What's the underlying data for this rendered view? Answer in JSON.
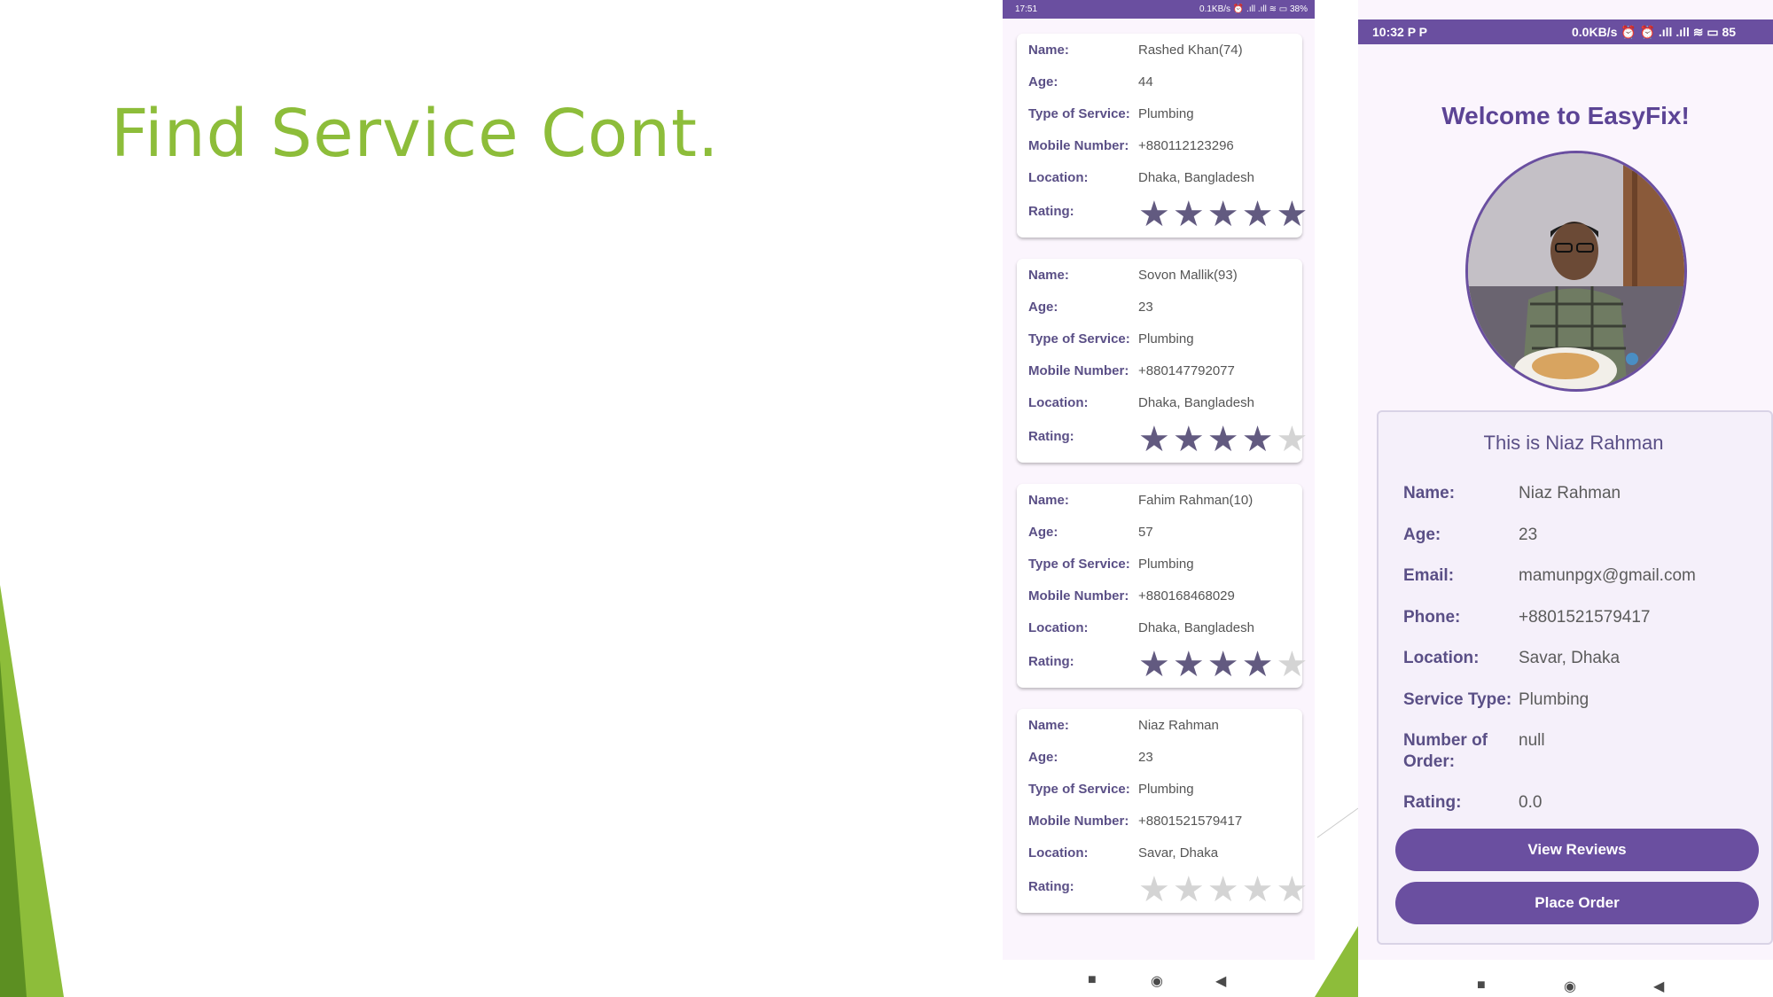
{
  "slide": {
    "title": "Find Service Cont."
  },
  "colors": {
    "accent_green": "#8dbd3a",
    "app_purple": "#6a4fa0",
    "label_purple": "#5a4f86"
  },
  "phone1": {
    "status": {
      "time": "17:51",
      "right": "0.1KB/s ⏰ .ıll .ıll ≋ ▭ 38%"
    },
    "field_labels": {
      "name": "Name:",
      "age": "Age:",
      "type": "Type of Service:",
      "mobile": "Mobile Number:",
      "location": "Location:",
      "rating": "Rating:"
    },
    "cards": [
      {
        "name": "Rashed Khan(74)",
        "age": "44",
        "type": "Plumbing",
        "mobile": "+880112123296",
        "location": "Dhaka, Bangladesh",
        "rating": 4.5
      },
      {
        "name": "Sovon Mallik(93)",
        "age": "23",
        "type": "Plumbing",
        "mobile": "+880147792077",
        "location": "Dhaka, Bangladesh",
        "rating": 4
      },
      {
        "name": "Fahim Rahman(10)",
        "age": "57",
        "type": "Plumbing",
        "mobile": "+880168468029",
        "location": "Dhaka, Bangladesh",
        "rating": 4
      },
      {
        "name": "Niaz Rahman",
        "age": "23",
        "type": "Plumbing",
        "mobile": "+8801521579417",
        "location": "Savar, Dhaka",
        "rating": 0
      }
    ],
    "nav": {
      "recent": "■",
      "home": "◉",
      "back": "◀"
    }
  },
  "phone2": {
    "status": {
      "time": "10:32 P P",
      "right": "0.0KB/s ⏰ ⏰ .ıll .ıll ≋ ▭ 85"
    },
    "welcome": "Welcome to EasyFix!",
    "avatar_icon": "profile-photo",
    "profile_title": "This is Niaz Rahman",
    "profile": [
      {
        "label": "Name:",
        "value": "Niaz Rahman"
      },
      {
        "label": "Age:",
        "value": "23"
      },
      {
        "label": "Email:",
        "value": "mamunpgx@gmail.com"
      },
      {
        "label": "Phone:",
        "value": "+8801521579417"
      },
      {
        "label": "Location:",
        "value": "Savar, Dhaka"
      },
      {
        "label": "Service Type:",
        "value": "Plumbing"
      },
      {
        "label": "Number of Order:",
        "value": "null"
      },
      {
        "label": "Rating:",
        "value": "0.0"
      }
    ],
    "buttons": {
      "view_reviews": "View Reviews",
      "place_order": "Place Order"
    },
    "nav": {
      "recent": "■",
      "home": "◉",
      "back": "◀"
    }
  }
}
